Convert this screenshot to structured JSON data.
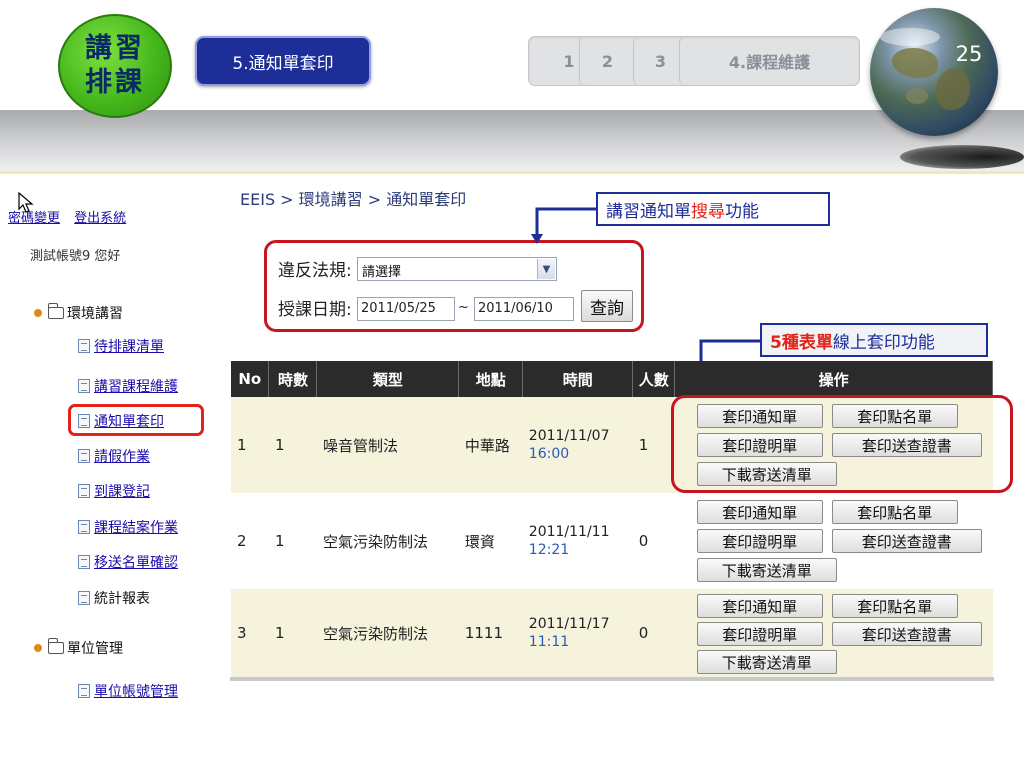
{
  "header": {
    "badge_line1": "講習",
    "badge_line2": "排課",
    "section_title": "5.通知單套印",
    "steps": [
      "1",
      "2",
      "3",
      "4.課程維護"
    ],
    "slide_number": "25"
  },
  "account": {
    "change_password": "密碼變更",
    "logout": "登出系統",
    "greeting": "測試帳號9 您好"
  },
  "sidebar": {
    "group1": "環境講習",
    "group1_items": [
      "待排課清單",
      "講習課程維護",
      "通知單套印",
      "請假作業",
      "到課登記",
      "課程結案作業",
      "移送名單確認",
      "統計報表"
    ],
    "group2": "單位管理",
    "group2_items": [
      "單位帳號管理"
    ]
  },
  "breadcrumb": "EEIS > 環境講習 > 通知單套印",
  "filter": {
    "law_label": "違反法規:",
    "law_value": "請選擇",
    "date_label": "授課日期:",
    "date_from": "2011/05/25",
    "tilde": "~",
    "date_to": "2011/06/10",
    "query_button": "查詢"
  },
  "callouts": {
    "search_pre": "講習通知單",
    "search_red": "搜尋",
    "search_post": "功能",
    "print_red": "5種表單",
    "print_post": "線上套印功能"
  },
  "table": {
    "headers": [
      "No",
      "時數",
      "類型",
      "地點",
      "時間",
      "人數",
      "操作"
    ],
    "rows": [
      {
        "no": "1",
        "hours": "1",
        "type": "噪音管制法",
        "place": "中華路",
        "date": "2011/11/07",
        "time": "16:00",
        "count": "1"
      },
      {
        "no": "2",
        "hours": "1",
        "type": "空氣污染防制法",
        "place": "環資",
        "date": "2011/11/11",
        "time": "12:21",
        "count": "0"
      },
      {
        "no": "3",
        "hours": "1",
        "type": "空氣污染防制法",
        "place": "1111",
        "date": "2011/11/17",
        "time": "11:11",
        "count": "0"
      }
    ],
    "actions": [
      "套印通知單",
      "套印點名單",
      "套印證明單",
      "套印送查證書",
      "下載寄送清單"
    ]
  },
  "colors": {
    "accent_navy": "#1d2e99",
    "highlight_red": "#c8141e",
    "badge_green": "#45b81c",
    "table_header": "#2b2b2b",
    "row_tint": "#f6f3dc"
  }
}
